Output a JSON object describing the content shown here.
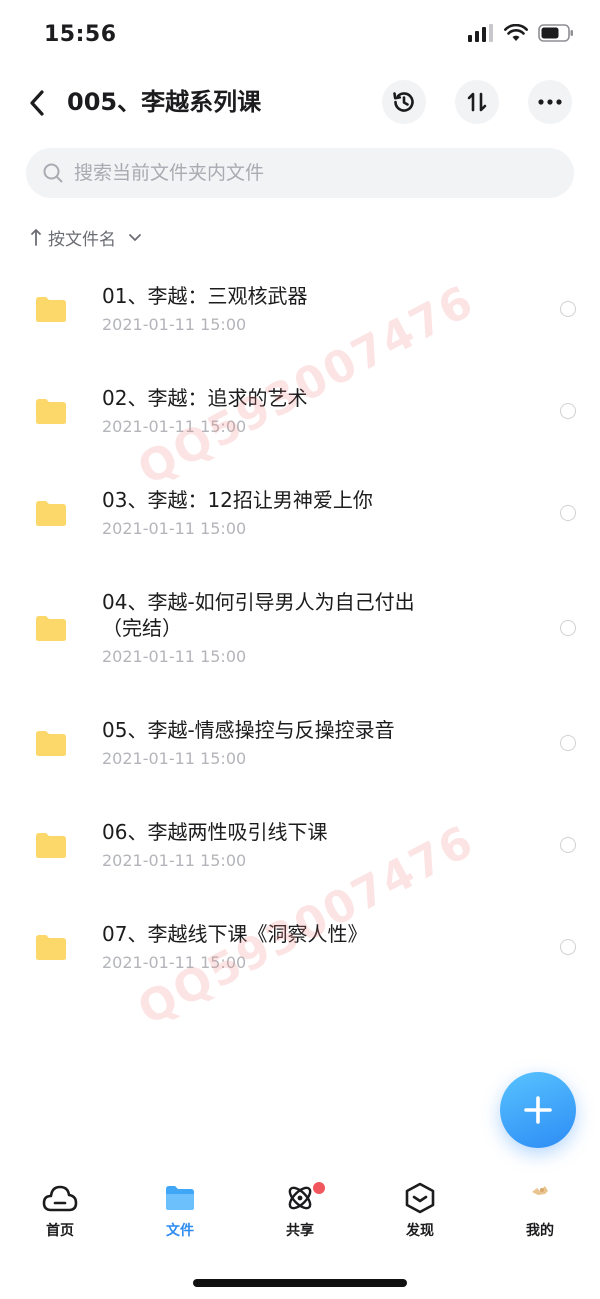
{
  "status_bar": {
    "time": "15:56"
  },
  "header": {
    "title": "005、李越系列课"
  },
  "search": {
    "placeholder": "搜索当前文件夹内文件",
    "value": ""
  },
  "sort": {
    "label": "按文件名"
  },
  "files": [
    {
      "name": "01、李越：三观核武器",
      "time": "2021-01-11 15:00"
    },
    {
      "name": "02、李越：追求的艺术",
      "time": "2021-01-11 15:00"
    },
    {
      "name": "03、李越：12招让男神爱上你",
      "time": "2021-01-11 15:00"
    },
    {
      "name": "04、李越-如何引导男人为自己付出\n（完结）",
      "time": "2021-01-11 15:00"
    },
    {
      "name": "05、李越-情感操控与反操控录音",
      "time": "2021-01-11 15:00"
    },
    {
      "name": "06、李越两性吸引线下课",
      "time": "2021-01-11 15:00"
    },
    {
      "name": "07、李越线下课《洞察人性》",
      "time": "2021-01-11 15:00"
    }
  ],
  "watermark": {
    "text": "QQ593007476"
  },
  "nav": {
    "items": [
      {
        "label": "首页",
        "icon": "cloud-home-icon"
      },
      {
        "label": "文件",
        "icon": "folder-icon",
        "active": true
      },
      {
        "label": "共享",
        "icon": "atom-share-icon",
        "badge": true
      },
      {
        "label": "发现",
        "icon": "discover-box-icon"
      },
      {
        "label": "我的",
        "icon": "avatar-icon"
      }
    ]
  },
  "colors": {
    "accent": "#2f8cf0",
    "folder": "#fcd86a",
    "badge": "#f0565c",
    "secondary_text": "#b3b5ba"
  }
}
